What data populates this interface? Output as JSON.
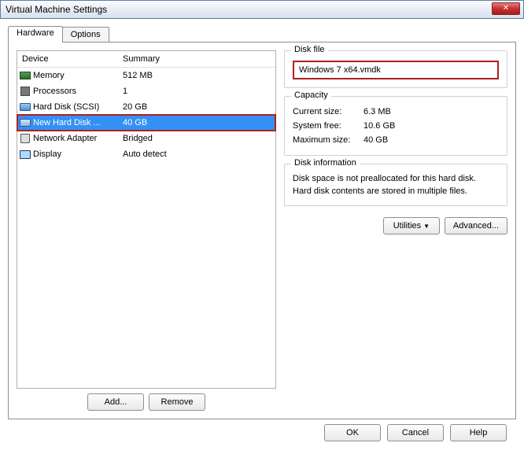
{
  "window": {
    "title": "Virtual Machine Settings"
  },
  "tabs": {
    "hardware": "Hardware",
    "options": "Options"
  },
  "columns": {
    "device": "Device",
    "summary": "Summary"
  },
  "devices": [
    {
      "name": "Memory",
      "summary": "512 MB",
      "icon": "memory"
    },
    {
      "name": "Processors",
      "summary": "1",
      "icon": "cpu"
    },
    {
      "name": "Hard Disk (SCSI)",
      "summary": "20 GB",
      "icon": "disk"
    },
    {
      "name": "New Hard Disk ...",
      "summary": "40 GB",
      "icon": "disk",
      "selected": true
    },
    {
      "name": "Network Adapter",
      "summary": "Bridged",
      "icon": "net"
    },
    {
      "name": "Display",
      "summary": "Auto detect",
      "icon": "display"
    }
  ],
  "buttonsLeft": {
    "add": "Add...",
    "remove": "Remove"
  },
  "diskFile": {
    "title": "Disk file",
    "value": "Windows 7 x64.vmdk"
  },
  "capacity": {
    "title": "Capacity",
    "currentLabel": "Current size:",
    "currentValue": "6.3 MB",
    "freeLabel": "System free:",
    "freeValue": "10.6 GB",
    "maxLabel": "Maximum size:",
    "maxValue": "40 GB"
  },
  "diskInfo": {
    "title": "Disk information",
    "line1": "Disk space is not preallocated for this hard disk.",
    "line2": "Hard disk contents are stored in multiple files."
  },
  "buttonsRight": {
    "utilities": "Utilities",
    "advanced": "Advanced..."
  },
  "footer": {
    "ok": "OK",
    "cancel": "Cancel",
    "help": "Help"
  }
}
